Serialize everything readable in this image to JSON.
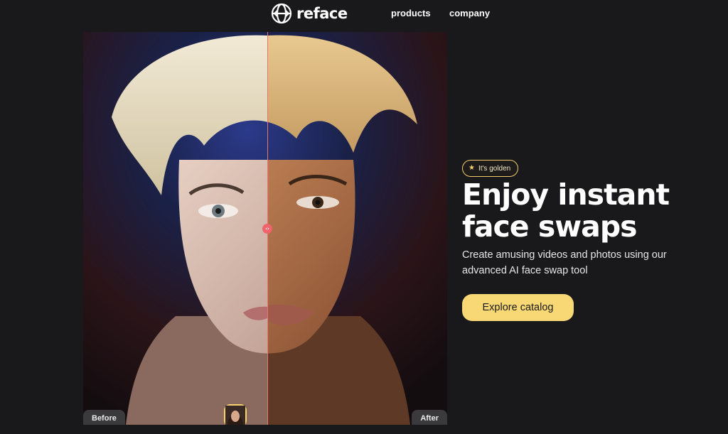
{
  "header": {
    "logo_text": "reface",
    "nav": [
      {
        "label": "products"
      },
      {
        "label": "company"
      }
    ]
  },
  "viewer": {
    "before_label": "Before",
    "after_label": "After",
    "handle_glyph": "‹›",
    "thumbnails": [
      {
        "name": "golden",
        "active": true
      },
      {
        "name": "pale-man",
        "active": false
      },
      {
        "name": "dark-hair-woman",
        "active": false
      }
    ]
  },
  "hero": {
    "badge_icon": "star-icon",
    "badge_text": "It's golden",
    "headline": "Enjoy instant face swaps",
    "subtitle": "Create amusing videos and photos using our advanced AI face swap tool",
    "cta_label": "Explore catalog"
  },
  "colors": {
    "background": "#19191b",
    "accent": "#f8d775",
    "divider": "#e9766e",
    "handle": "#f0636b"
  }
}
